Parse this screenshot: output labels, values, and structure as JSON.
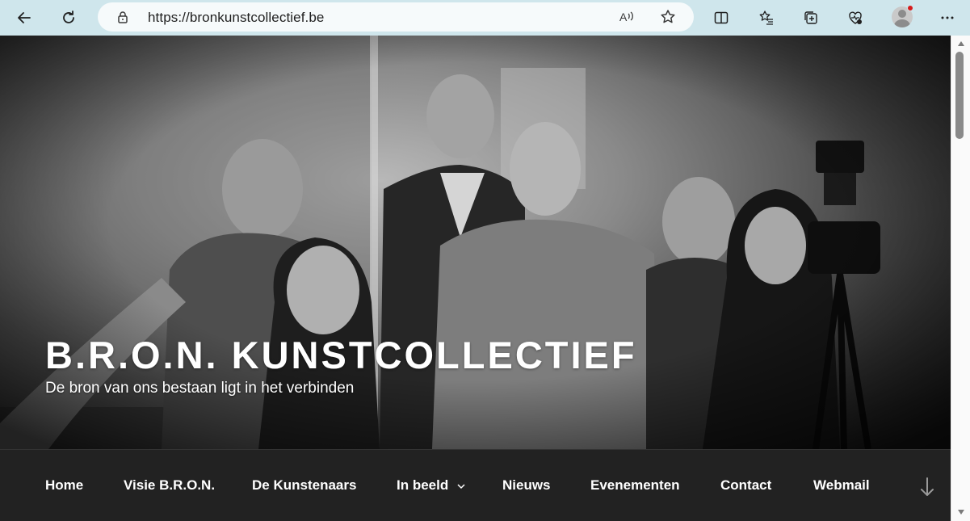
{
  "browser": {
    "url": "https://bronkunstcollectief.be",
    "icons": [
      "back-icon",
      "refresh-icon",
      "lock-icon",
      "read-aloud-icon",
      "favorite-star-icon",
      "split-screen-icon",
      "favorites-list-icon",
      "collections-icon",
      "browser-essentials-icon",
      "profile-avatar",
      "more-menu-icon"
    ]
  },
  "hero": {
    "title": "B.R.O.N. KUNSTCOLLECTIEF",
    "description": "De bron van ons bestaan ligt in het verbinden"
  },
  "nav": {
    "items": [
      {
        "label": "Home"
      },
      {
        "label": "Visie B.R.O.N."
      },
      {
        "label": "De Kunstenaars"
      },
      {
        "label": "In beeld",
        "has_submenu": true
      },
      {
        "label": "Nieuws"
      },
      {
        "label": "Evenementen"
      },
      {
        "label": "Contact"
      },
      {
        "label": "Webmail"
      }
    ]
  },
  "colors": {
    "toolbar_bg": "#cfe6ec",
    "nav_bg": "#222222",
    "title_text": "#ffffff"
  }
}
